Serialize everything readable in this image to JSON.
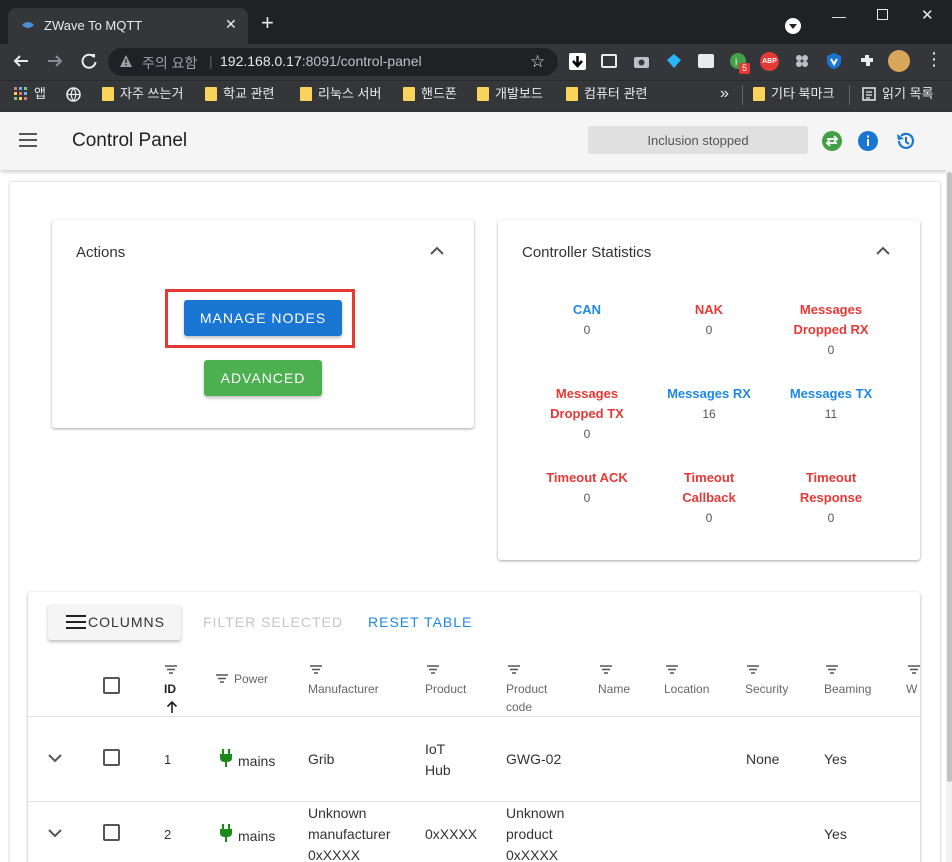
{
  "browser": {
    "tab_title": "ZWave To MQTT",
    "warning_text": "주의 요함",
    "url_host": "192.168.0.17",
    "url_path": ":8091/control-panel",
    "bookmarks": [
      "앱",
      "자주 쓰는거",
      "학교 관련",
      "리눅스 서버",
      "핸드폰",
      "개발보드",
      "컴퓨터 관련",
      "기타 북마크",
      "읽기 목록"
    ],
    "overflow_label": "»",
    "ext_badge": "5",
    "abp_label": "ABP"
  },
  "app": {
    "title": "Control Panel",
    "inclusion_status": "Inclusion stopped"
  },
  "actions": {
    "title": "Actions",
    "manage_nodes": "MANAGE NODES",
    "advanced": "ADVANCED"
  },
  "stats": {
    "title": "Controller Statistics",
    "items": [
      {
        "label": "CAN",
        "value": "0",
        "color": "#1e88e5"
      },
      {
        "label": "NAK",
        "value": "0",
        "color": "#e53935"
      },
      {
        "label": "Messages Dropped RX",
        "value": "0",
        "color": "#e53935"
      },
      {
        "label": "Messages Dropped TX",
        "value": "0",
        "color": "#e53935"
      },
      {
        "label": "Messages RX",
        "value": "16",
        "color": "#1e88e5"
      },
      {
        "label": "Messages TX",
        "value": "11",
        "color": "#1e88e5"
      },
      {
        "label": "Timeout ACK",
        "value": "0",
        "color": "#e53935"
      },
      {
        "label": "Timeout Callback",
        "value": "0",
        "color": "#e53935"
      },
      {
        "label": "Timeout Response",
        "value": "0",
        "color": "#e53935"
      }
    ]
  },
  "table": {
    "columns_button": "COLUMNS",
    "filter_selected": "FILTER SELECTED",
    "reset_table": "RESET TABLE",
    "headers": [
      "ID",
      "Power",
      "Manufacturer",
      "Product",
      "Product code",
      "Name",
      "Location",
      "Security",
      "Beaming",
      "W"
    ],
    "rows": [
      {
        "id": "1",
        "power": "mains",
        "manufacturer": "Grib",
        "product": "IoT Hub",
        "product_code": "GWG-02",
        "name": "",
        "location": "",
        "security": "None",
        "beaming": "Yes"
      },
      {
        "id": "2",
        "power": "mains",
        "manufacturer": "Unknown manufacturer 0xXXXX",
        "product": "0xXXXX",
        "product_code": "Unknown product 0xXXXX",
        "name": "",
        "location": "",
        "security": "",
        "beaming": "Yes"
      }
    ]
  },
  "colors": {
    "primary": "#1976d2",
    "success": "#4caf50",
    "highlight": "#e53935",
    "stat_blue": "#1e88e5",
    "stat_red": "#e53935"
  }
}
